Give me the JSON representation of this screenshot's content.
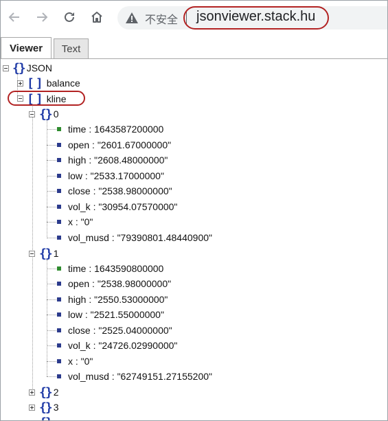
{
  "browser": {
    "back_icon": "arrow-left-icon",
    "forward_icon": "arrow-right-icon",
    "reload_icon": "reload-icon",
    "home_icon": "home-icon",
    "warning_icon": "warning-triangle-icon",
    "security_label": "不安全",
    "url": "jsonviewer.stack.hu",
    "highlight_color": "#b22222"
  },
  "tabs": [
    {
      "label": "Viewer",
      "active": true
    },
    {
      "label": "Text",
      "active": false
    }
  ],
  "tree": {
    "root": "JSON",
    "balance": "balance",
    "kline": "kline",
    "item0": {
      "index": "0",
      "fields": [
        {
          "text": "time : 1643587200000",
          "type": "number"
        },
        {
          "text": "open : \"2601.67000000\"",
          "type": "string"
        },
        {
          "text": "high : \"2608.48000000\"",
          "type": "string"
        },
        {
          "text": "low : \"2533.17000000\"",
          "type": "string"
        },
        {
          "text": "close : \"2538.98000000\"",
          "type": "string"
        },
        {
          "text": "vol_k : \"30954.07570000\"",
          "type": "string"
        },
        {
          "text": "x : \"0\"",
          "type": "string"
        },
        {
          "text": "vol_musd : \"79390801.48440900\"",
          "type": "string"
        }
      ]
    },
    "item1": {
      "index": "1",
      "fields": [
        {
          "text": "time : 1643590800000",
          "type": "number"
        },
        {
          "text": "open : \"2538.98000000\"",
          "type": "string"
        },
        {
          "text": "high : \"2550.53000000\"",
          "type": "string"
        },
        {
          "text": "low : \"2521.55000000\"",
          "type": "string"
        },
        {
          "text": "close : \"2525.04000000\"",
          "type": "string"
        },
        {
          "text": "vol_k : \"24726.02990000\"",
          "type": "string"
        },
        {
          "text": "x : \"0\"",
          "type": "string"
        },
        {
          "text": "vol_musd : \"62749151.27155200\"",
          "type": "string"
        }
      ]
    },
    "item2": "2",
    "item3": "3"
  }
}
